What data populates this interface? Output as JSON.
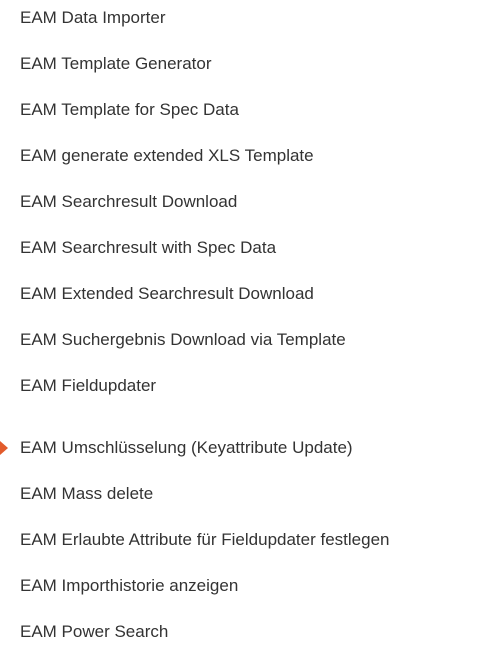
{
  "menu": {
    "items": [
      {
        "label": "EAM Data Importer",
        "active": false
      },
      {
        "label": "EAM Template Generator",
        "active": false
      },
      {
        "label": "EAM Template for Spec Data",
        "active": false
      },
      {
        "label": "EAM generate extended XLS Template",
        "active": false
      },
      {
        "label": "EAM Searchresult Download",
        "active": false
      },
      {
        "label": "EAM Searchresult with Spec Data",
        "active": false
      },
      {
        "label": "EAM Extended Searchresult Download",
        "active": false
      },
      {
        "label": "EAM Suchergebnis Download via Template",
        "active": false
      },
      {
        "label": "EAM Fieldupdater",
        "active": false
      },
      {
        "label": "EAM Umschlüsselung (Keyattribute Update)",
        "active": true
      },
      {
        "label": "EAM Mass delete",
        "active": false
      },
      {
        "label": "EAM Erlaubte Attribute für Fieldupdater festlegen",
        "active": false
      },
      {
        "label": "EAM Importhistorie anzeigen",
        "active": false
      },
      {
        "label": "EAM Power Search",
        "active": false
      }
    ],
    "active_marker_color": "#e25b2b",
    "text_color": "#333333"
  }
}
